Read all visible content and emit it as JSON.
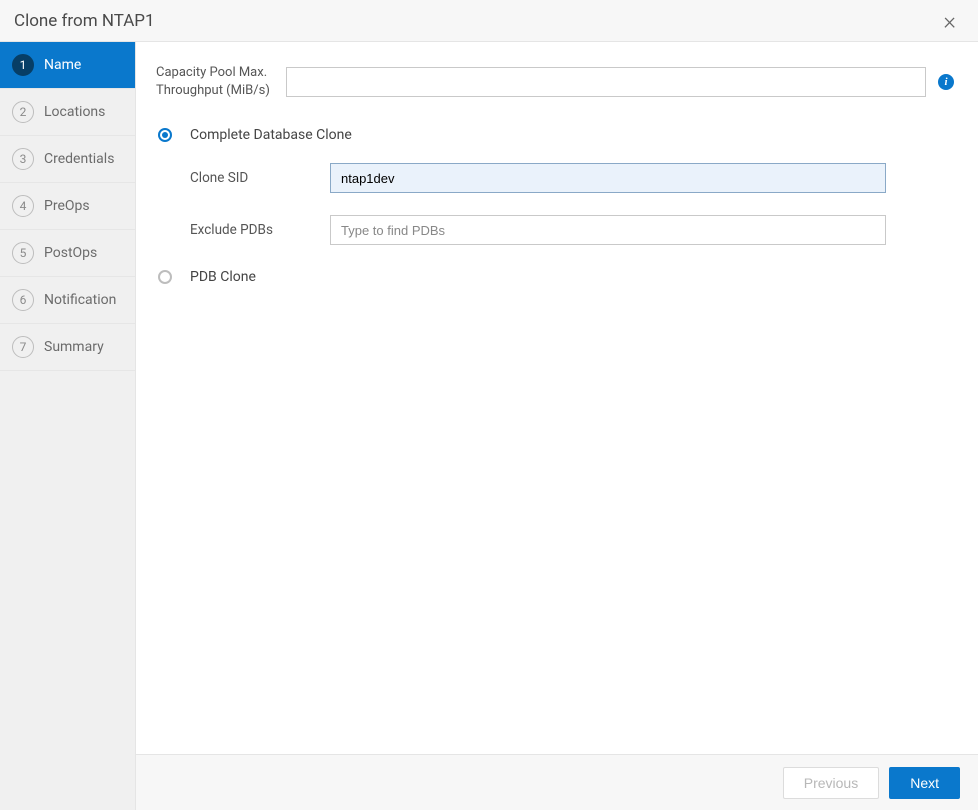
{
  "header": {
    "title": "Clone from NTAP1"
  },
  "steps": [
    {
      "num": "1",
      "label": "Name",
      "active": true
    },
    {
      "num": "2",
      "label": "Locations",
      "active": false
    },
    {
      "num": "3",
      "label": "Credentials",
      "active": false
    },
    {
      "num": "4",
      "label": "PreOps",
      "active": false
    },
    {
      "num": "5",
      "label": "PostOps",
      "active": false
    },
    {
      "num": "6",
      "label": "Notification",
      "active": false
    },
    {
      "num": "7",
      "label": "Summary",
      "active": false
    }
  ],
  "form": {
    "capacity_label": "Capacity Pool Max. Throughput (MiB/s)",
    "capacity_value": "",
    "option_complete": {
      "label": "Complete Database Clone",
      "selected": true,
      "clone_sid_label": "Clone SID",
      "clone_sid_value": "ntap1dev",
      "exclude_pdbs_label": "Exclude PDBs",
      "exclude_pdbs_placeholder": "Type to find PDBs",
      "exclude_pdbs_value": ""
    },
    "option_pdb": {
      "label": "PDB Clone",
      "selected": false
    }
  },
  "footer": {
    "previous_label": "Previous",
    "next_label": "Next"
  }
}
